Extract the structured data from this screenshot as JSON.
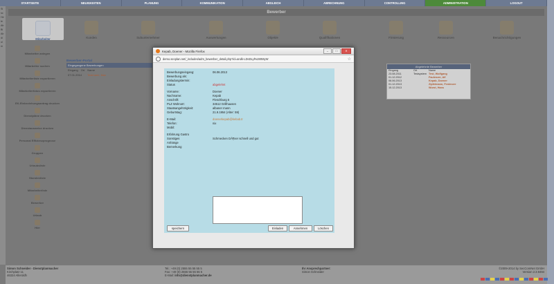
{
  "nav": {
    "items": [
      "STARTSEITE",
      "NEUIGKEITEN",
      "PLANUNG",
      "KOMMUNIKATION",
      "ABGLEICH",
      "ABRECHNUNG",
      "CONTROLLING",
      "ADMINISTRATION",
      "LOGOUT"
    ],
    "active": "ADMINISTRATION"
  },
  "section_title": "Bewerber",
  "icons": [
    "Mitarbeiter",
    "Kunden",
    "Subunternehmer",
    "Auswertungen",
    "Objekte",
    "Qualifikationen",
    "Firmierung",
    "Ressourcen",
    "Benachrichtigungen"
  ],
  "sidebar": [
    "Mitarbeiter anlegen",
    "Mitarbeiter suchen",
    "Mitarbeiterliste exportieren",
    "Mitarbeiterfotos exportieren",
    "EK-Einbeziehungsantrag drucken",
    "Dienstpläne drucken",
    "Dienstausweise drucken",
    "Personal Effizienzprognose",
    "Gruppen",
    "Urlaubsliste",
    "Stundenliste",
    "Mitarbeiterliste",
    "Bewerber",
    "Urlaub",
    "Hier"
  ],
  "portal": {
    "title": "Bewerber-Portal",
    "header": "Eingegangene Bewerbungen",
    "cols": [
      "Eingang",
      "Ort",
      "Name"
    ],
    "row": [
      "07.01.2014",
      "",
      "Testmann, Max"
    ]
  },
  "right_box": {
    "title": "Abgelehnte Bewerber",
    "cols": [
      "Eingang",
      "Ort",
      "Name"
    ],
    "rows": [
      [
        "23.08.2011",
        "Testsystem",
        "Test, Wolfgang"
      ],
      [
        "01.12.2012",
        "",
        "Faulenzer, Alf"
      ],
      [
        "06.06.2013",
        "",
        "Kepab, Doener"
      ],
      [
        "01.12.2013",
        "",
        "Zipfelmann, Fenimore"
      ],
      [
        "15.12.2013",
        "",
        "Wurst, Hans"
      ]
    ]
  },
  "dialog": {
    "title": "Kepab, Doener - Mozilla Firefox",
    "url": "demo.secplan.net/_includes/adm_bewerber_detail.php?id=andk-LDsDLyl%280MyW",
    "fields": [
      {
        "label": "Bewerbungseingang:",
        "value": "06.06.2013"
      },
      {
        "label": "Bewerbung als:",
        "value": ""
      },
      {
        "label": "Einladungstermin:",
        "value": ""
      },
      {
        "label": "Status",
        "value": "abgelehnt"
      },
      {
        "label": "Vorname:",
        "value": "Doener"
      },
      {
        "label": "Nachname:",
        "value": "Kepab"
      },
      {
        "label": "Anschrift:",
        "value": "Fleschburg 5"
      },
      {
        "label": "PLZ Wohnort:",
        "value": "34512 Grillhausen"
      },
      {
        "label": "Staatsangehörigkeit:",
        "value": "albaner mann"
      },
      {
        "label": "Geburtstag:",
        "value": "21.9.1954 (Alter: 59)"
      },
      {
        "label": "E-Mail:",
        "value": "doenerkepab@kebab.tr"
      },
      {
        "label": "Telefon:",
        "value": "nix"
      },
      {
        "label": "Mobil:",
        "value": ""
      },
      {
        "label": "Erfahrung Gastro",
        "value": ""
      },
      {
        "label": "Sonstiges",
        "value": "Schmecken DÃ¶ner schnell und gut"
      },
      {
        "label": "Anhänge",
        "value": ""
      },
      {
        "label": "Bemerkung",
        "value": ""
      }
    ],
    "buttons": {
      "save": "speichern",
      "invite": "Einladen",
      "accept": "Annehmen",
      "delete": "Löschen"
    }
  },
  "footer": {
    "company": "Simon Schneider - Dienstplanmacher",
    "street": "Kirchplatz 11",
    "city": "46324 Alleroldh",
    "tel": "Tel.: +49 (0) 2555 55 55 55 5",
    "fax": "Fax: +49 (0) 2555 55 55 55 5",
    "email_label": "E-Mail:",
    "email": "info@dienstplanmacher.de",
    "contact_title": "Ihr Ansprechpartner:",
    "contact_name": "Simon Schneider",
    "copyright": "©2009-2014 by SecComNet GmbH",
    "version": "Version 2.3.9494"
  },
  "left_strip": [
    "Si",
    "sc",
    "He",
    "te",
    "Ab",
    "Bi",
    "Ab",
    "di",
    "ui",
    "m"
  ]
}
